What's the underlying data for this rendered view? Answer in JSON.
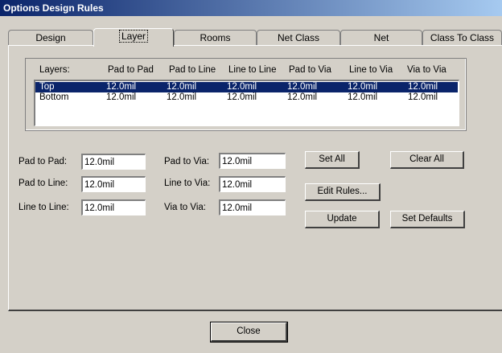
{
  "window": {
    "title": "Options Design Rules"
  },
  "tabs": [
    {
      "label": "Design"
    },
    {
      "label": "Layer"
    },
    {
      "label": "Rooms"
    },
    {
      "label": "Net Class"
    },
    {
      "label": "Net"
    },
    {
      "label": "Class To Class"
    }
  ],
  "active_tab": "Layer",
  "grid": {
    "headers": [
      "Layers:",
      "Pad to Pad",
      "Pad to Line",
      "Line to Line",
      "Pad to Via",
      "Line to Via",
      "Via to Via"
    ],
    "rows": [
      {
        "layer": "Top",
        "values": [
          "12.0mil",
          "12.0mil",
          "12.0mil",
          "12.0mil",
          "12.0mil",
          "12.0mil"
        ],
        "selected": true
      },
      {
        "layer": "Bottom",
        "values": [
          "12.0mil",
          "12.0mil",
          "12.0mil",
          "12.0mil",
          "12.0mil",
          "12.0mil"
        ],
        "selected": false
      }
    ]
  },
  "fields": {
    "pad_to_pad": {
      "label": "Pad to Pad:",
      "value": "12.0mil"
    },
    "pad_to_line": {
      "label": "Pad to Line:",
      "value": "12.0mil"
    },
    "line_to_line": {
      "label": "Line to Line:",
      "value": "12.0mil"
    },
    "pad_to_via": {
      "label": "Pad to Via:",
      "value": "12.0mil"
    },
    "line_to_via": {
      "label": "Line to Via:",
      "value": "12.0mil"
    },
    "via_to_via": {
      "label": "Via to Via:",
      "value": "12.0mil"
    }
  },
  "buttons": {
    "set_all": "Set All",
    "clear_all": "Clear All",
    "edit_rules": "Edit Rules...",
    "update": "Update",
    "set_defaults": "Set Defaults",
    "close": "Close"
  },
  "colors": {
    "face": "#d4d0c8",
    "selection": "#0a246a",
    "title_start": "#0a246a",
    "title_end": "#a6caf0"
  }
}
